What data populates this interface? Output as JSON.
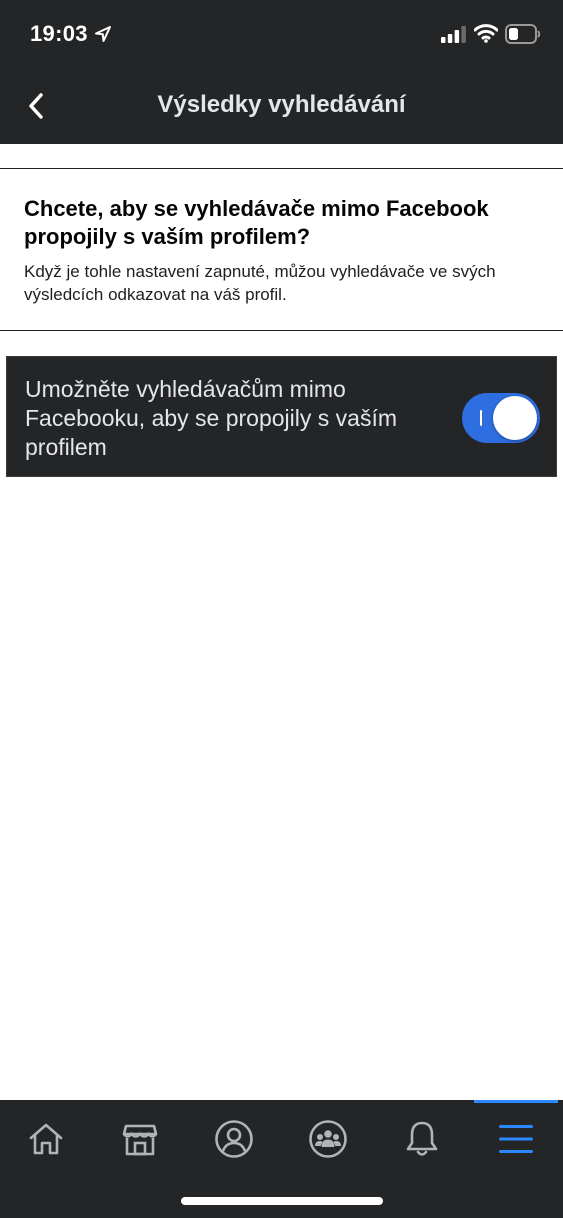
{
  "status_bar": {
    "time": "19:03",
    "icons": [
      "location-arrow-icon",
      "cellular-signal-icon",
      "wifi-icon",
      "battery-icon"
    ]
  },
  "nav": {
    "back_icon": "chevron-left-icon",
    "title": "Výsledky vyhledávání"
  },
  "info": {
    "heading": "Chcete, aby se vyhledávače mimo Facebook propojily s vaším profilem?",
    "body": "Když je tohle nastavení zapnuté, můžou vyhledávače ve svých výsledcích odkazovat na váš profil."
  },
  "setting": {
    "label": "Umožněte vyhledávačům mimo Facebooku, aby se propojily s vaším profilem",
    "enabled": true
  },
  "tabs": [
    {
      "icon": "home-icon"
    },
    {
      "icon": "marketplace-icon"
    },
    {
      "icon": "profile-icon"
    },
    {
      "icon": "groups-icon"
    },
    {
      "icon": "notifications-bell-icon"
    },
    {
      "icon": "menu-icon",
      "active": true
    }
  ],
  "colors": {
    "header_bg": "#242526",
    "accent": "#2d88ff",
    "switch_on": "#2d6ee0"
  }
}
